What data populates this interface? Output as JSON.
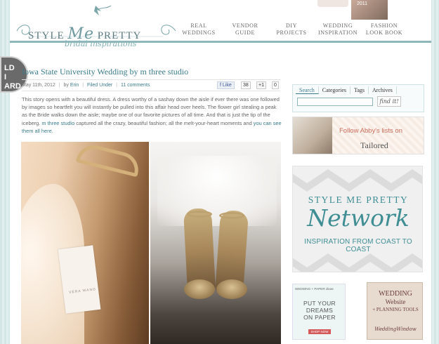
{
  "header": {
    "logo_style": "STYLE",
    "logo_me": "Me",
    "logo_pretty": "PRETTY",
    "logo_sub": "bridal inspirations",
    "nav": [
      {
        "line1": "REAL",
        "line2": "WEDDINGS"
      },
      {
        "line1": "VENDOR",
        "line2": "GUIDE"
      },
      {
        "line1": "DIY",
        "line2": "PROJECTS"
      },
      {
        "line1": "WEDDING",
        "line2": "INSPIRATION"
      },
      {
        "line1": "FASHION",
        "line2": "LOOK BOOK"
      }
    ],
    "ad_year": "2011"
  },
  "seal": {
    "line1": "LD",
    "line2": "I",
    "line3": "ARD"
  },
  "post": {
    "title": "Iowa State University Wedding by m three studio",
    "meta": {
      "date": "May 11th, 2012",
      "by_prefix": "by",
      "author": "Erin",
      "filed_label": "Filed Under",
      "comments": "11 comments"
    },
    "social": {
      "like_label": "Like",
      "like_count": "38",
      "gplus_label": "+1",
      "gplus_count": "0"
    },
    "body_part1": "This story opens with a beautiful dress. A dress worthy of a sashay down the aisle if ever there was one followed by images so heartfelt you will instantly be pulled into this affair head over heels. The flower girl stealing a peak as the Bride walks down the aisle; maybe one of our favorite pictures of all time. And that is just the tip of the iceberg.",
    "body_link1": "m three studio",
    "body_part2": "captured all the crazy, beautiful fashion; all the melt-your-heart moments and",
    "body_link2": "you can see them all here",
    "body_end": ".",
    "photo_tag": "VERA WANG"
  },
  "sidebar": {
    "search_tabs": [
      "Search",
      "Categories",
      "Tags",
      "Archives"
    ],
    "search_value": "",
    "find_label": "find it!",
    "tailored": {
      "cta": "Follow Abby's lists on",
      "brand": "Tailored"
    },
    "network": {
      "line1": "STYLE ME PRETTY",
      "line2": "Network",
      "line3": "INSPIRATION FROM COAST TO COAST"
    },
    "wp_ad": {
      "brand": "WEDDING + PAPER divas",
      "line1": "PUT YOUR",
      "line2": "DREAMS",
      "line3": "ON PAPER",
      "button": "SHOP NOW"
    },
    "ww_ad": {
      "line1": "WEDDING",
      "line2": "Website",
      "line3": "+ PLANNING TOOLS",
      "line4": "WeddingWindow"
    }
  },
  "colors": {
    "accent": "#3b7c8c",
    "header_rule": "#8fb7b9",
    "background": "#dbe9ea",
    "coral": "#c96e5d"
  }
}
